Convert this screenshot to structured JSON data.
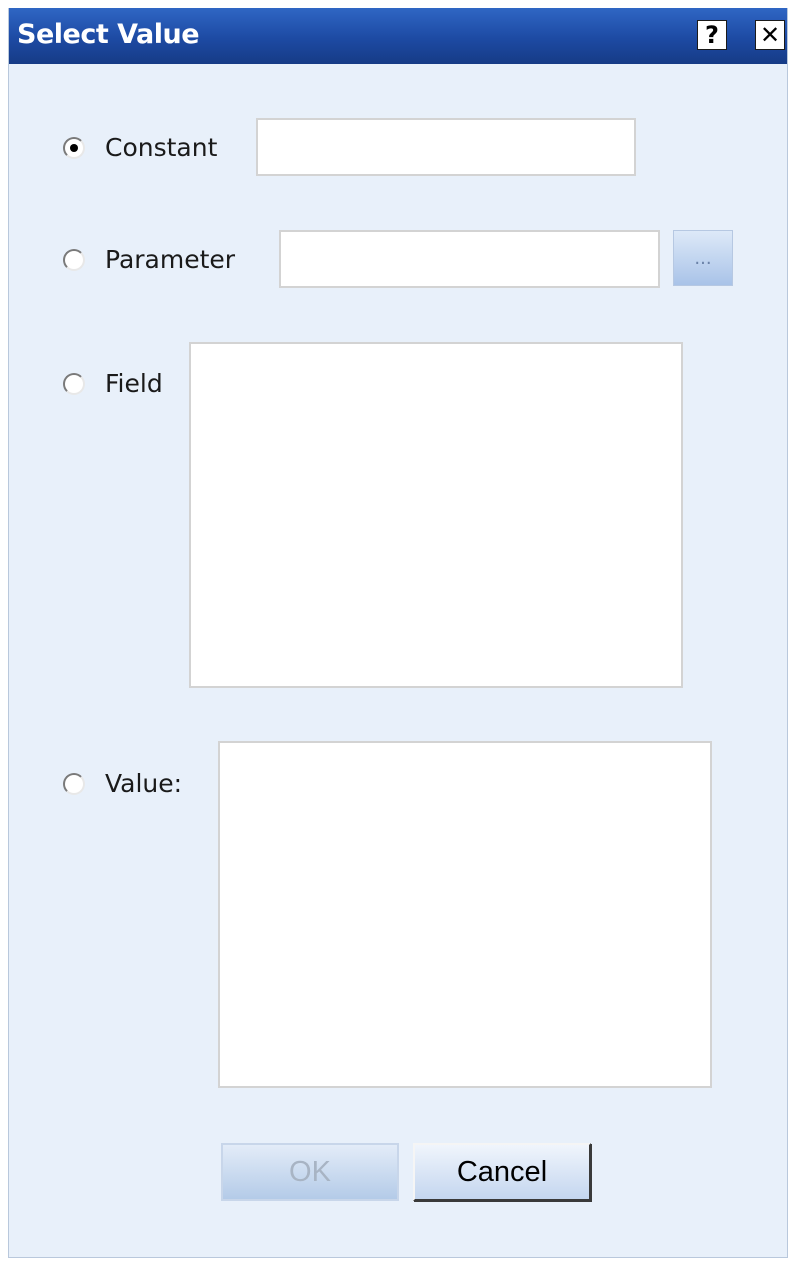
{
  "dialog": {
    "title": "Select Value",
    "help_label": "?",
    "close_label": "✕"
  },
  "options": {
    "constant": {
      "label": "Constant",
      "selected": true,
      "value": ""
    },
    "parameter": {
      "label": "Parameter",
      "selected": false,
      "value": "",
      "browse_label": "..."
    },
    "field": {
      "label": "Field",
      "selected": false
    },
    "value": {
      "label": "Value:",
      "selected": false
    }
  },
  "buttons": {
    "ok_label": "OK",
    "ok_enabled": false,
    "cancel_label": "Cancel"
  },
  "colors": {
    "title_bar": "#1d4aa3",
    "dialog_background": "#e8f0fa"
  }
}
